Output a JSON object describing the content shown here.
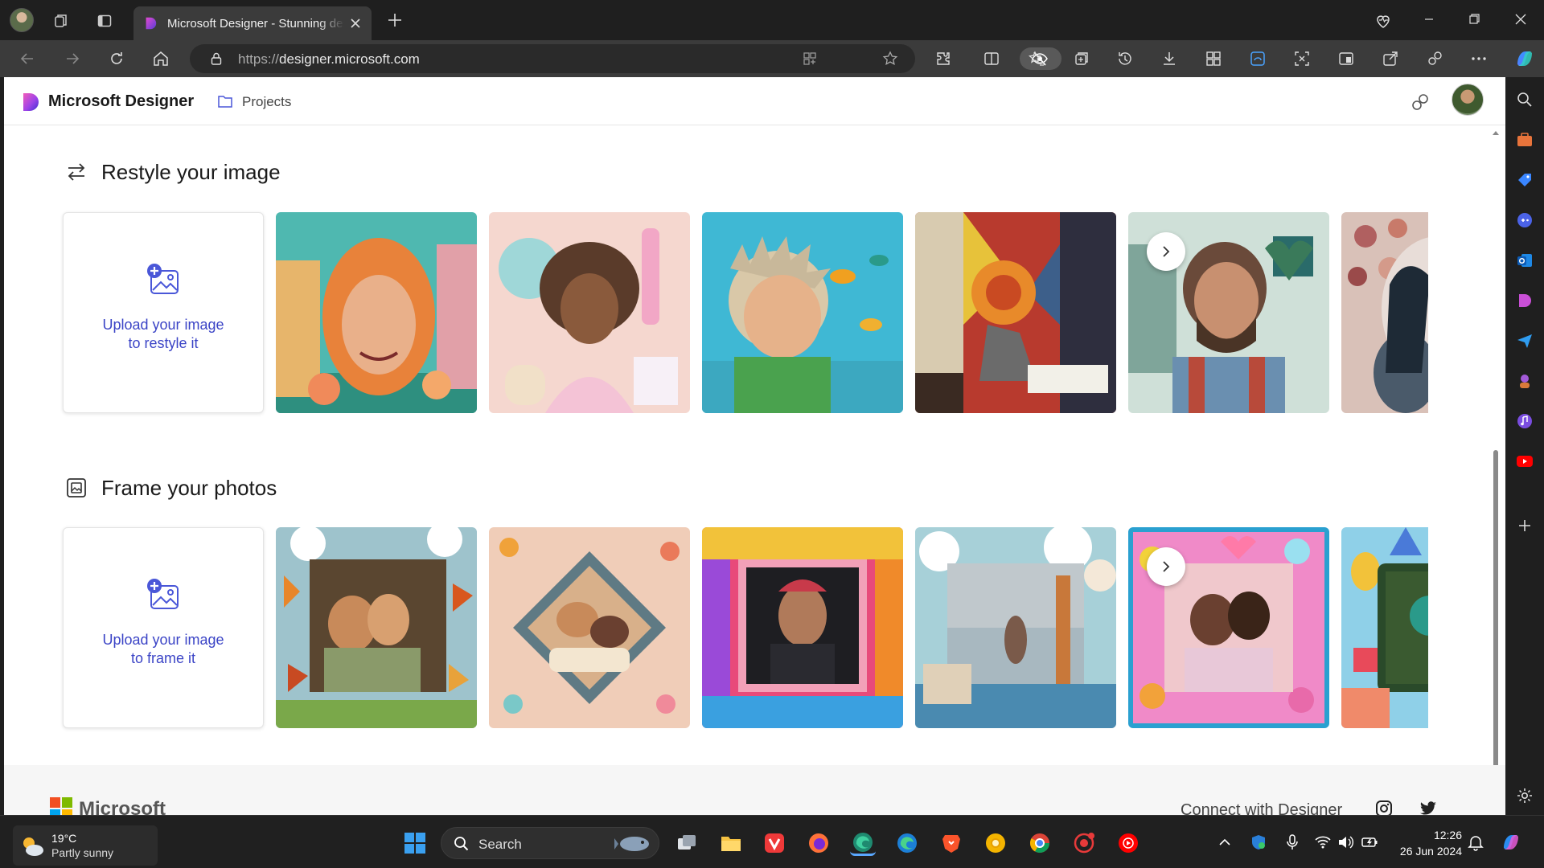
{
  "browser": {
    "tab_title": "Microsoft Designer - Stunning designs in a flash",
    "url_scheme": "https://",
    "url_host": "designer.microsoft.com"
  },
  "app": {
    "brand_name": "Microsoft Designer",
    "projects_label": "Projects"
  },
  "sections": [
    {
      "title": "Restyle your image",
      "upload_text_line1": "Upload your image",
      "upload_text_line2": "to restyle it",
      "thumbnails": [
        "paper-craft-woman-hijab",
        "clay-scientist-woman",
        "cartoon-man-aquarium",
        "cubist-writer",
        "pixel-art-bearded-man",
        "mosaic-hearts-portrait"
      ]
    },
    {
      "title": "Frame your photos",
      "upload_text_line1": "Upload your image",
      "upload_text_line2": "to frame it",
      "thumbnails": [
        "autumn-leaves-frame",
        "pastel-toys-frame",
        "makeup-palette-frame",
        "venice-clouds-frame",
        "neon-flowers-frame",
        "party-gifts-frame"
      ]
    }
  ],
  "footer": {
    "brand": "Microsoft",
    "connect_label": "Connect with Designer"
  },
  "taskbar": {
    "weather_temp": "19°C",
    "weather_desc": "Partly sunny",
    "search_label": "Search",
    "time": "12:26",
    "date": "26 Jun 2024"
  },
  "colors": {
    "accent_link": "#3b44c6",
    "browser_dark": "#1f1f1f",
    "toolbar": "#3b3b3b"
  }
}
